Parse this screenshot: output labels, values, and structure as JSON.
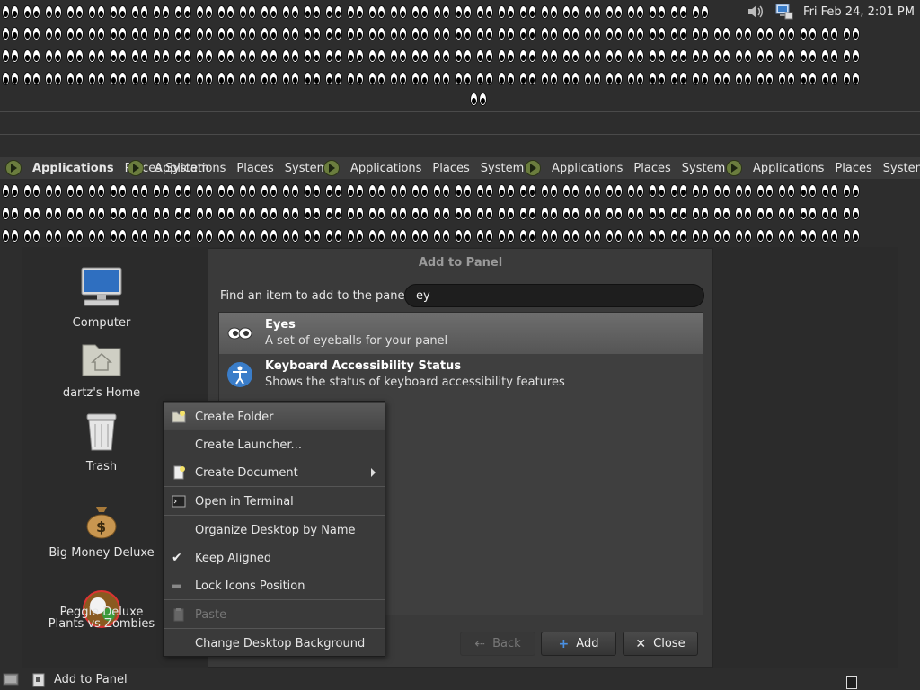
{
  "top_panel": {
    "clock": "Fri Feb 24,  2:01 PM",
    "tray_icons": [
      "volume-icon",
      "network-icon"
    ]
  },
  "center_eyes_label": "",
  "menubar": {
    "groups": [
      {
        "applications": "Applications",
        "places": "Places",
        "system": "System"
      },
      {
        "applications": "Applications",
        "places": "Places",
        "system": "System"
      },
      {
        "applications": "Applications",
        "places": "Places",
        "system": "System"
      },
      {
        "applications": "Applications",
        "places": "Places",
        "system": "System"
      }
    ],
    "overlap_text": "Places System"
  },
  "desktop": {
    "icons": [
      {
        "label": "Computer",
        "icon": "computer-icon"
      },
      {
        "label": "dartz's Home",
        "icon": "home-folder-icon"
      },
      {
        "label": "Trash",
        "icon": "trash-icon"
      },
      {
        "label": "Big Money Deluxe",
        "icon": "money-bag-icon"
      },
      {
        "label": "Peggle Deluxe",
        "label2": "Plants vs Zombies",
        "icon": "game-icon"
      }
    ]
  },
  "dialog": {
    "title": "Add to Panel",
    "find_label": "Find an item to add to the panel:",
    "search_value": "ey",
    "items": [
      {
        "title": "Eyes",
        "description": "A set of eyeballs for your panel",
        "icon": "eyes-icon",
        "selected": true
      },
      {
        "title": "Keyboard Accessibility Status",
        "description": "Shows the status of keyboard accessibility features",
        "icon": "accessibility-icon",
        "selected": false
      }
    ],
    "buttons": {
      "back": "Back",
      "add": "Add",
      "close": "Close"
    }
  },
  "context_menu": {
    "items": [
      {
        "label": "Create Folder",
        "icon": "new-folder-icon"
      },
      {
        "label": "Create Launcher..."
      },
      {
        "label": "Create Document",
        "icon": "new-document-icon",
        "submenu": true
      },
      {
        "label": "Open in Terminal",
        "icon": "terminal-icon"
      },
      {
        "label": "Organize Desktop by Name"
      },
      {
        "label": "Keep Aligned",
        "checked": true
      },
      {
        "label": "Lock Icons Position"
      },
      {
        "label": "Paste",
        "icon": "paste-icon",
        "disabled": true
      },
      {
        "label": "Change Desktop Background"
      }
    ]
  },
  "bottom_panel": {
    "task_label": "Add to Panel"
  },
  "colors": {
    "panel_bg": "#2d2d2d",
    "menubar_bg": "#3a3a3a",
    "dialog_bg": "#3a3a3a",
    "selected_row": "#606060",
    "accent_blue": "#3a7dc9"
  }
}
